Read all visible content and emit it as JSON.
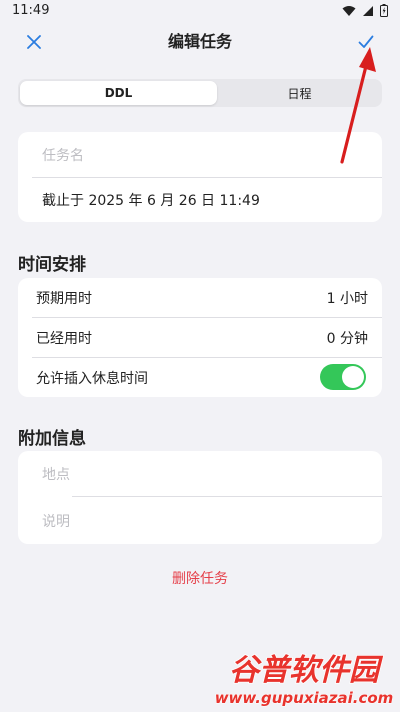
{
  "status_bar": {
    "time": "11:49"
  },
  "header": {
    "title": "编辑任务",
    "close_icon": "close-icon",
    "confirm_icon": "check-icon"
  },
  "segmented": {
    "options": [
      "DDL",
      "日程"
    ],
    "selected": "DDL"
  },
  "task_card": {
    "name_placeholder": "任务名",
    "deadline": "截止于 2025 年 6 月 26 日 11:49"
  },
  "time_section": {
    "title": "时间安排",
    "rows": [
      {
        "label": "预期用时",
        "value": "1 小时"
      },
      {
        "label": "已经用时",
        "value": "0 分钟"
      }
    ],
    "break_toggle": {
      "label": "允许插入休息时间",
      "on": true
    }
  },
  "extra_section": {
    "title": "附加信息",
    "location_placeholder": "地点",
    "description_placeholder": "说明"
  },
  "delete_label": "删除任务",
  "watermark": {
    "text": "谷普软件园",
    "url": "www.gupuxiazai.com"
  },
  "colors": {
    "background": "#f2f2f6",
    "accent_blue": "#2b7de0",
    "toggle_green": "#34c759",
    "delete_red": "#e5404a",
    "annotation_arrow": "#d81e1e"
  }
}
